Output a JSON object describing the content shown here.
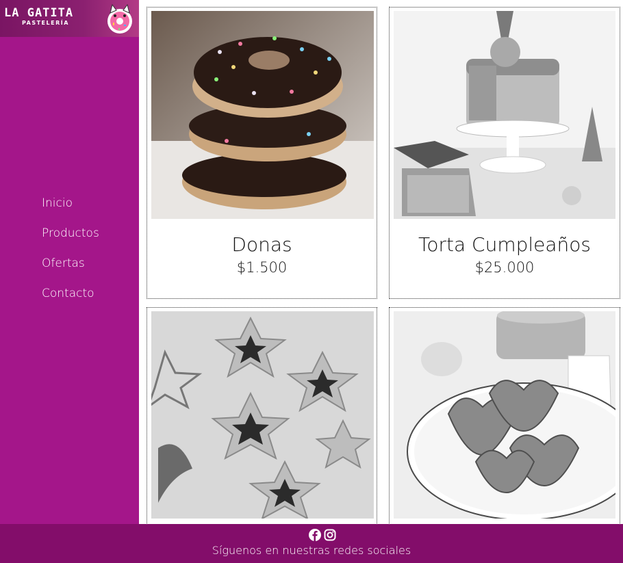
{
  "brand": {
    "name": "LA GATITA",
    "subtitle": "PASTELERÍA"
  },
  "nav": {
    "items": [
      {
        "label": "Inicio"
      },
      {
        "label": "Productos"
      },
      {
        "label": "Ofertas"
      },
      {
        "label": "Contacto"
      }
    ]
  },
  "products": [
    {
      "name": "Donas",
      "price": "$1.500",
      "image": "stacked sprinkled chocolate donuts"
    },
    {
      "name": "Torta Cumpleaños",
      "price": "$25.000",
      "image": "birthday drip cake with ice cream cone"
    },
    {
      "name": "",
      "price": "",
      "image": "star shaped jam cookies with cutter"
    },
    {
      "name": "",
      "price": "",
      "image": "palmier pastries on plate"
    }
  ],
  "footer": {
    "text": "Síguenos en nuestras redes sociales",
    "icons": [
      "facebook-icon",
      "instagram-icon"
    ]
  },
  "colors": {
    "sidebar": "#a4168a",
    "footer": "#830d6a",
    "text_on_brand": "#ffffff"
  }
}
